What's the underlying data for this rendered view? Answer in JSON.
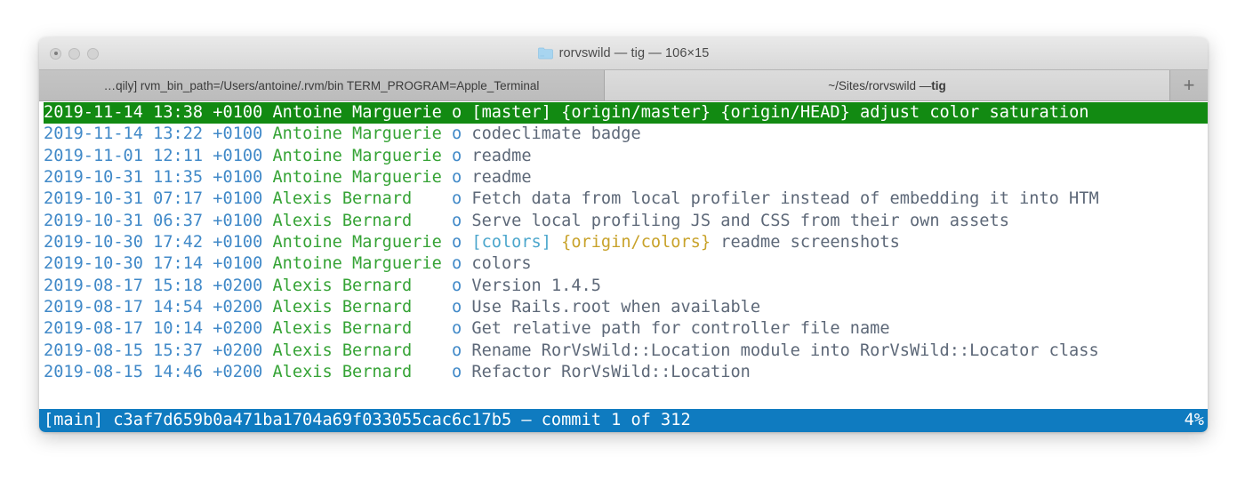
{
  "window": {
    "title": "rorvswild — tig — 106×15",
    "folder_icon": "folder-icon",
    "traffic_lights": [
      "close",
      "minimize",
      "zoom"
    ]
  },
  "tabs": [
    {
      "label": "…qily] rvm_bin_path=/Users/antoine/.rvm/bin TERM_PROGRAM=Apple_Terminal",
      "active": false
    },
    {
      "label_prefix": "~/Sites/rorvswild — ",
      "label_bold": "tig",
      "active": true
    }
  ],
  "new_tab_button": "+",
  "terminal": {
    "columns": 106,
    "rows": 15,
    "commits": [
      {
        "date": "2019-11-14 13:38 +0100",
        "author": "Antoine Marguerie",
        "graph": "o",
        "branch": "[master]",
        "remote": "{origin/master} {origin/HEAD}",
        "message": "adjust color saturation",
        "selected": true
      },
      {
        "date": "2019-11-14 13:22 +0100",
        "author": "Antoine Marguerie",
        "graph": "o",
        "branch": "",
        "remote": "",
        "message": "codeclimate badge",
        "selected": false
      },
      {
        "date": "2019-11-01 12:11 +0100",
        "author": "Antoine Marguerie",
        "graph": "o",
        "branch": "",
        "remote": "",
        "message": "readme",
        "selected": false
      },
      {
        "date": "2019-10-31 11:35 +0100",
        "author": "Antoine Marguerie",
        "graph": "o",
        "branch": "",
        "remote": "",
        "message": "readme",
        "selected": false
      },
      {
        "date": "2019-10-31 07:17 +0100",
        "author": "Alexis Bernard",
        "graph": "o",
        "branch": "",
        "remote": "",
        "message": "Fetch data from local profiler instead of embedding it into HTM",
        "selected": false
      },
      {
        "date": "2019-10-31 06:37 +0100",
        "author": "Alexis Bernard",
        "graph": "o",
        "branch": "",
        "remote": "",
        "message": "Serve local profiling JS and CSS from their own assets",
        "selected": false
      },
      {
        "date": "2019-10-30 17:42 +0100",
        "author": "Antoine Marguerie",
        "graph": "o",
        "branch": "[colors]",
        "remote": "{origin/colors}",
        "message": "readme screenshots",
        "selected": false
      },
      {
        "date": "2019-10-30 17:14 +0100",
        "author": "Antoine Marguerie",
        "graph": "o",
        "branch": "",
        "remote": "",
        "message": "colors",
        "selected": false
      },
      {
        "date": "2019-08-17 15:18 +0200",
        "author": "Alexis Bernard",
        "graph": "o",
        "branch": "",
        "remote": "",
        "message": "Version 1.4.5",
        "selected": false
      },
      {
        "date": "2019-08-17 14:54 +0200",
        "author": "Alexis Bernard",
        "graph": "o",
        "branch": "",
        "remote": "",
        "message": "Use Rails.root when available",
        "selected": false
      },
      {
        "date": "2019-08-17 10:14 +0200",
        "author": "Alexis Bernard",
        "graph": "o",
        "branch": "",
        "remote": "",
        "message": "Get relative path for controller file name",
        "selected": false
      },
      {
        "date": "2019-08-15 15:37 +0200",
        "author": "Alexis Bernard",
        "graph": "o",
        "branch": "",
        "remote": "",
        "message": "Rename RorVsWild::Location module into RorVsWild::Locator class",
        "selected": false
      },
      {
        "date": "2019-08-15 14:46 +0200",
        "author": "Alexis Bernard",
        "graph": "o",
        "branch": "",
        "remote": "",
        "message": "Refactor RorVsWild::Location",
        "selected": false
      }
    ]
  },
  "statusbar": {
    "left": "[main] c3af7d659b0a471ba1704a69f033055cac6c17b5 — commit 1 of 312",
    "right": "4%"
  },
  "colors": {
    "date": "#4089c8",
    "author": "#35a335",
    "graph": "#4089c8",
    "message": "#5d6878",
    "branch": "#4ba6cc",
    "remote": "#c8a22a",
    "selected_bg": "#128a12",
    "statusbar_bg": "#0f7bc0"
  }
}
